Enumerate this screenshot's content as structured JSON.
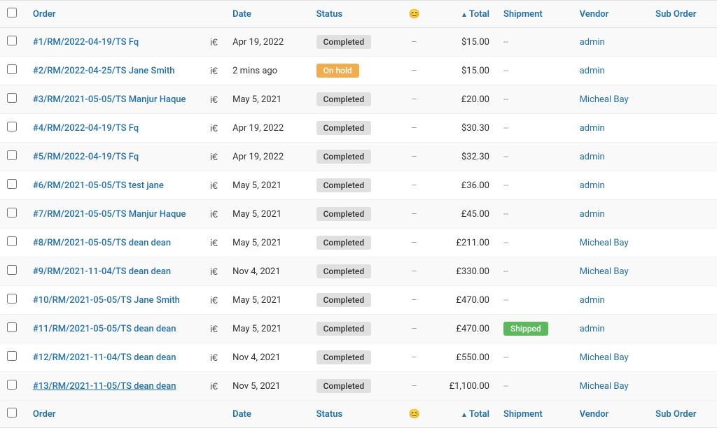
{
  "table": {
    "columns": {
      "order": "Order",
      "date": "Date",
      "status": "Status",
      "emoji": "😊",
      "total": "Total",
      "shipment": "Shipment",
      "vendor": "Vendor",
      "suborder": "Sub Order"
    },
    "rows": [
      {
        "id": "row-1",
        "checkbox": false,
        "order": "#1/RM/2022-04-19/TS Fq",
        "order_underline": false,
        "date": "Apr 19, 2022",
        "status": "Completed",
        "status_type": "completed",
        "emoji": "",
        "total": "$15.00",
        "shipment": "--",
        "vendor": "admin",
        "suborder": ""
      },
      {
        "id": "row-2",
        "checkbox": false,
        "order": "#2/RM/2022-04-25/TS Jane Smith",
        "order_underline": false,
        "date": "2 mins ago",
        "status": "On hold",
        "status_type": "on-hold",
        "emoji": "",
        "total": "$15.00",
        "shipment": "--",
        "vendor": "admin",
        "suborder": ""
      },
      {
        "id": "row-3",
        "checkbox": false,
        "order": "#3/RM/2021-05-05/TS Manjur Haque",
        "order_underline": false,
        "date": "May 5, 2021",
        "status": "Completed",
        "status_type": "completed",
        "emoji": "",
        "total": "£20.00",
        "shipment": "--",
        "vendor": "Micheal Bay",
        "suborder": ""
      },
      {
        "id": "row-4",
        "checkbox": false,
        "order": "#4/RM/2022-04-19/TS Fq",
        "order_underline": false,
        "date": "Apr 19, 2022",
        "status": "Completed",
        "status_type": "completed",
        "emoji": "",
        "total": "$30.30",
        "shipment": "--",
        "vendor": "admin",
        "suborder": ""
      },
      {
        "id": "row-5",
        "checkbox": false,
        "order": "#5/RM/2022-04-19/TS Fq",
        "order_underline": false,
        "date": "Apr 19, 2022",
        "status": "Completed",
        "status_type": "completed",
        "emoji": "",
        "total": "$32.30",
        "shipment": "--",
        "vendor": "admin",
        "suborder": ""
      },
      {
        "id": "row-6",
        "checkbox": false,
        "order": "#6/RM/2021-05-05/TS test jane",
        "order_underline": false,
        "date": "May 5, 2021",
        "status": "Completed",
        "status_type": "completed",
        "emoji": "",
        "total": "£36.00",
        "shipment": "--",
        "vendor": "admin",
        "suborder": ""
      },
      {
        "id": "row-7",
        "checkbox": false,
        "order": "#7/RM/2021-05-05/TS Manjur Haque",
        "order_underline": false,
        "date": "May 5, 2021",
        "status": "Completed",
        "status_type": "completed",
        "emoji": "",
        "total": "£45.00",
        "shipment": "--",
        "vendor": "admin",
        "suborder": ""
      },
      {
        "id": "row-8",
        "checkbox": false,
        "order": "#8/RM/2021-05-05/TS dean dean",
        "order_underline": false,
        "date": "May 5, 2021",
        "status": "Completed",
        "status_type": "completed",
        "emoji": "",
        "total": "£211.00",
        "shipment": "--",
        "vendor": "Micheal Bay",
        "suborder": ""
      },
      {
        "id": "row-9",
        "checkbox": false,
        "order": "#9/RM/2021-11-04/TS dean dean",
        "order_underline": false,
        "date": "Nov 4, 2021",
        "status": "Completed",
        "status_type": "completed",
        "emoji": "",
        "total": "£330.00",
        "shipment": "--",
        "vendor": "Micheal Bay",
        "suborder": ""
      },
      {
        "id": "row-10",
        "checkbox": false,
        "order": "#10/RM/2021-05-05/TS Jane Smith",
        "order_underline": false,
        "date": "May 5, 2021",
        "status": "Completed",
        "status_type": "completed",
        "emoji": "",
        "total": "£470.00",
        "shipment": "--",
        "vendor": "admin",
        "suborder": ""
      },
      {
        "id": "row-11",
        "checkbox": false,
        "order": "#11/RM/2021-05-05/TS dean dean",
        "order_underline": false,
        "date": "May 5, 2021",
        "status": "Completed",
        "status_type": "completed",
        "emoji": "",
        "total": "£470.00",
        "shipment": "Shipped",
        "shipment_type": "shipped",
        "vendor": "admin",
        "suborder": ""
      },
      {
        "id": "row-12",
        "checkbox": false,
        "order": "#12/RM/2021-11-04/TS dean dean",
        "order_underline": false,
        "date": "Nov 4, 2021",
        "status": "Completed",
        "status_type": "completed",
        "emoji": "",
        "total": "£550.00",
        "shipment": "--",
        "vendor": "Micheal Bay",
        "suborder": ""
      },
      {
        "id": "row-13",
        "checkbox": false,
        "order": "#13/RM/2021-11-05/TS dean dean",
        "order_underline": true,
        "date": "Nov 5, 2021",
        "status": "Completed",
        "status_type": "completed",
        "emoji": "",
        "total": "£1,100.00",
        "shipment": "--",
        "vendor": "Micheal Bay",
        "suborder": ""
      }
    ],
    "footer": {
      "order": "Order",
      "date": "Date",
      "status": "Status",
      "emoji": "😊",
      "total": "Total",
      "shipment": "Shipment",
      "vendor": "Vendor",
      "suborder": "Sub Order"
    }
  }
}
